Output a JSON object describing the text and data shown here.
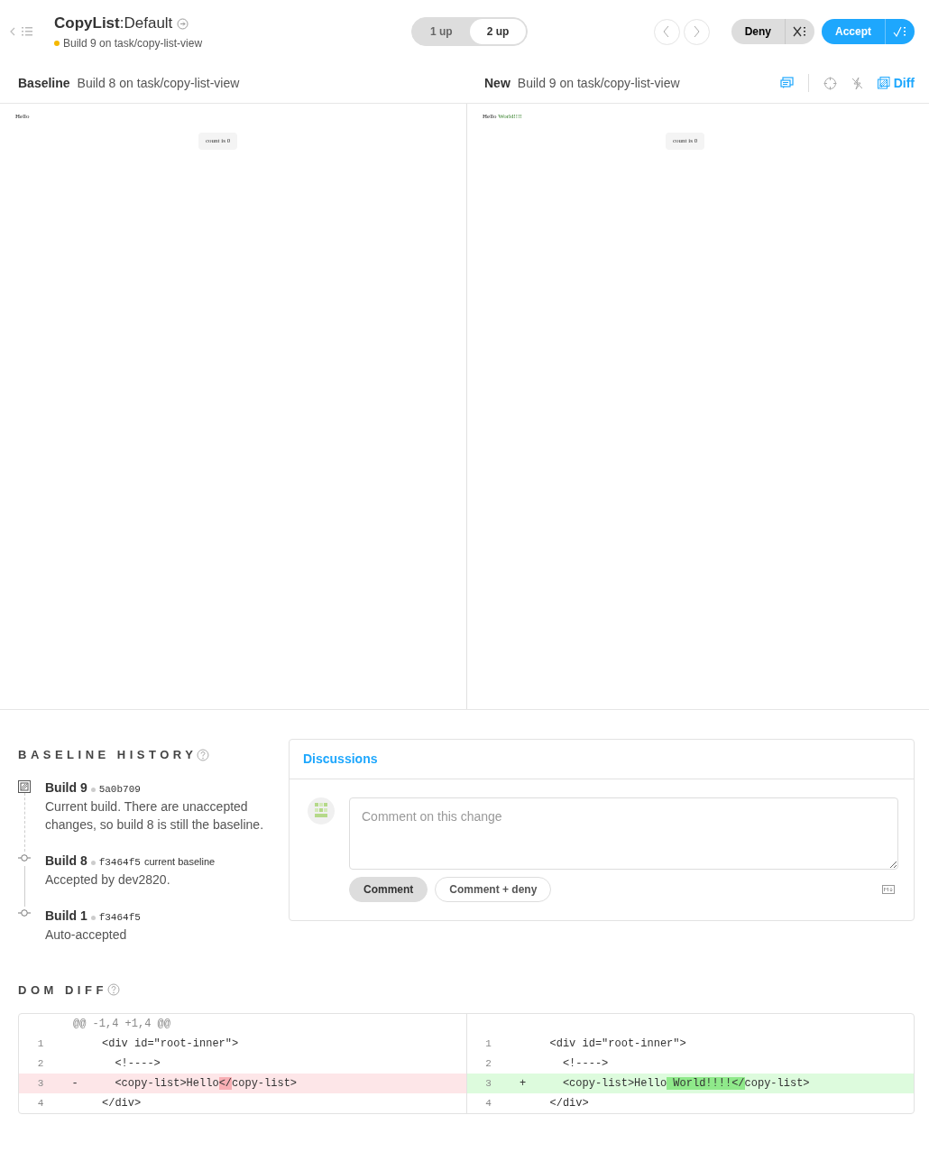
{
  "header": {
    "component": "CopyList",
    "separator": ":",
    "story": "Default",
    "build": "Build 9 on task/copy-list-view"
  },
  "view_modes": [
    {
      "label": "1 up",
      "selected": false
    },
    {
      "label": "2 up",
      "selected": true
    }
  ],
  "actions": {
    "deny": "Deny",
    "accept": "Accept"
  },
  "panes": [
    {
      "label": "Baseline",
      "build": "Build 8 on task/copy-list-view",
      "snapshot": {
        "text": "Hello",
        "button": "count is 0"
      }
    },
    {
      "label": "New",
      "build": "Build 9 on task/copy-list-view",
      "snapshot": {
        "text": "Hello",
        "added_text": "World!!!!",
        "button": "count is 0"
      }
    }
  ],
  "toolbar": {
    "diff_label": "Diff",
    "diff_on": true
  },
  "baseline_history": {
    "title": "BASELINE HISTORY",
    "items": [
      {
        "kind": "current",
        "build": "Build 9",
        "commit": "5a0b709",
        "description": "Current build. There are unaccepted changes, so build 8 is still the baseline."
      },
      {
        "kind": "commit",
        "build": "Build 8",
        "commit": "f3464f5",
        "note": "current baseline",
        "description": "Accepted by dev2820."
      },
      {
        "kind": "commit",
        "build": "Build 1",
        "commit": "f3464f5",
        "description": "Auto-accepted"
      }
    ]
  },
  "discussions": {
    "title": "Discussions",
    "placeholder": "Comment on this change",
    "buttons": [
      "Comment",
      "Comment + deny"
    ]
  },
  "dom_diff": {
    "title": "DOM DIFF",
    "hunk": "@@ -1,4 +1,4 @@",
    "rows": [
      {
        "kind": "context",
        "left_num": "1",
        "right_num": "1",
        "left": [
          {
            "text": "<div id=\"root-inner\">",
            "changed": false
          }
        ],
        "right": [
          {
            "text": "<div id=\"root-inner\">",
            "changed": false
          }
        ]
      },
      {
        "kind": "context",
        "left_num": "2",
        "right_num": "2",
        "left": [
          {
            "text": "  <!---->",
            "changed": false
          }
        ],
        "right": [
          {
            "text": "  <!---->",
            "changed": false
          }
        ]
      },
      {
        "kind": "change",
        "left_num": "3",
        "right_num": "3",
        "left_sign": "-",
        "right_sign": "+",
        "left": [
          {
            "text": "  <copy-list>Hello",
            "changed": false
          },
          {
            "text": "</",
            "changed": true
          },
          {
            "text": "copy-list>",
            "changed": false
          }
        ],
        "right": [
          {
            "text": "  <copy-list>Hello",
            "changed": false
          },
          {
            "text": " World!!!!</",
            "changed": true
          },
          {
            "text": "copy-list>",
            "changed": false
          }
        ]
      },
      {
        "kind": "context",
        "left_num": "4",
        "right_num": "4",
        "left": [
          {
            "text": "</div>",
            "changed": false
          }
        ],
        "right": [
          {
            "text": "</div>",
            "changed": false
          }
        ]
      }
    ]
  }
}
